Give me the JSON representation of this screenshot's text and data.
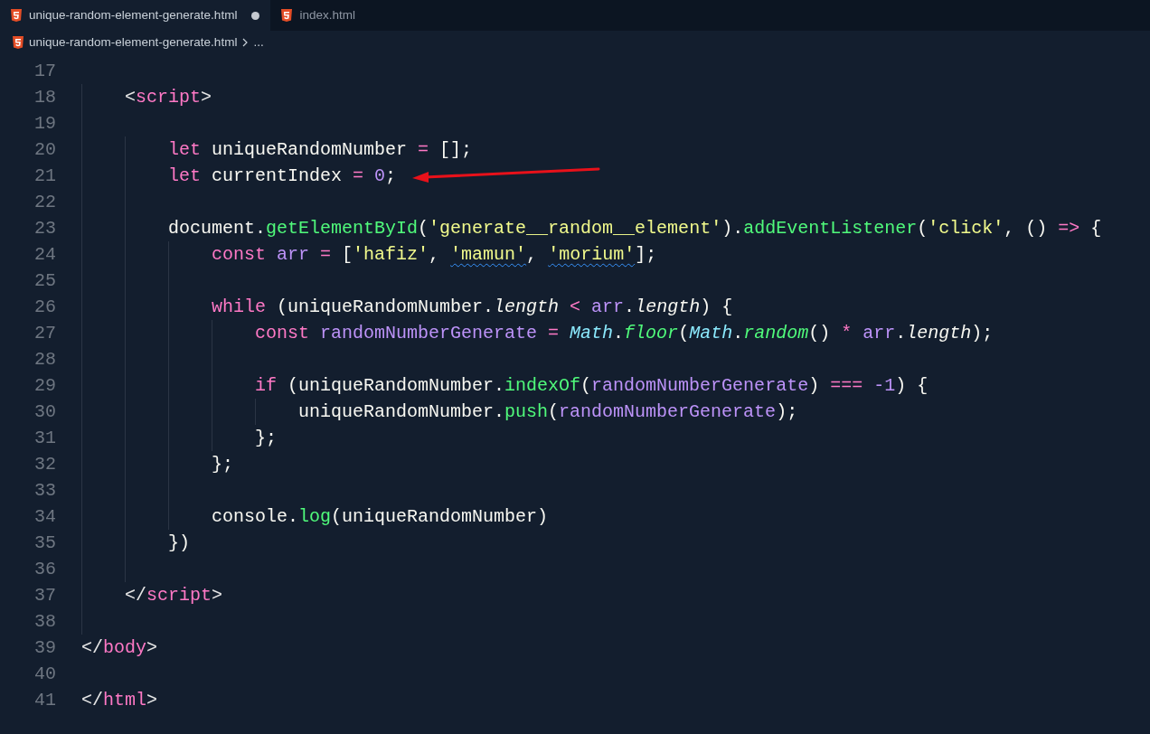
{
  "tabs": [
    {
      "label": "unique-random-element-generate.html",
      "selected": true,
      "modified": true
    },
    {
      "label": "index.html",
      "selected": false,
      "modified": false
    }
  ],
  "breadcrumb": {
    "file": "unique-random-element-generate.html",
    "ellipsis": "..."
  },
  "lines": [
    {
      "children": [
        {
          "number": "17"
        },
        {
          "number": "18",
          "tokens": [
            {
              "text": "<",
              "kind": "punct"
            },
            {
              "text": "script",
              "kind": "tag"
            },
            {
              "text": ">",
              "kind": "punct"
            }
          ],
          "children": [
            {
              "number": "19"
            },
            {
              "number": "20",
              "tokens": [
                {
                  "text": "let",
                  "kind": "kw"
                },
                {
                  "text": " uniqueRandomNumber ",
                  "kind": "plain"
                },
                {
                  "text": "=",
                  "kind": "op"
                },
                {
                  "text": " [];",
                  "kind": "plain"
                }
              ]
            },
            {
              "number": "21",
              "tokens": [
                {
                  "text": "let",
                  "kind": "kw"
                },
                {
                  "text": " currentIndex ",
                  "kind": "plain"
                },
                {
                  "text": "= ",
                  "kind": "op"
                },
                {
                  "text": "0",
                  "kind": "num"
                },
                {
                  "text": ";",
                  "kind": "plain"
                }
              ]
            },
            {
              "number": "22"
            },
            {
              "number": "23",
              "tokens": [
                {
                  "text": "document.",
                  "kind": "plain"
                },
                {
                  "text": "getElementById",
                  "kind": "fn"
                },
                {
                  "text": "(",
                  "kind": "plain"
                },
                {
                  "text": "'generate__random__element'",
                  "kind": "str"
                },
                {
                  "text": ").",
                  "kind": "plain"
                },
                {
                  "text": "addEventListener",
                  "kind": "fn"
                },
                {
                  "text": "(",
                  "kind": "plain"
                },
                {
                  "text": "'click'",
                  "kind": "str"
                },
                {
                  "text": ", () ",
                  "kind": "plain"
                },
                {
                  "text": "=>",
                  "kind": "op"
                },
                {
                  "text": " {",
                  "kind": "plain"
                }
              ],
              "children": [
                {
                  "number": "24",
                  "tokens": [
                    {
                      "text": "const ",
                      "kind": "kw"
                    },
                    {
                      "text": "arr ",
                      "kind": "var"
                    },
                    {
                      "text": "=",
                      "kind": "op"
                    },
                    {
                      "text": " [",
                      "kind": "plain"
                    },
                    {
                      "text": "'hafiz'",
                      "kind": "str"
                    },
                    {
                      "text": ", ",
                      "kind": "plain"
                    },
                    {
                      "text": "'mamun'",
                      "kind": "str",
                      "squiggle": true
                    },
                    {
                      "text": ", ",
                      "kind": "plain"
                    },
                    {
                      "text": "'morium'",
                      "kind": "str",
                      "squiggle": true
                    },
                    {
                      "text": "];",
                      "kind": "plain"
                    }
                  ]
                },
                {
                  "number": "25"
                },
                {
                  "number": "26",
                  "tokens": [
                    {
                      "text": "while",
                      "kind": "kw"
                    },
                    {
                      "text": " (uniqueRandomNumber.",
                      "kind": "plain"
                    },
                    {
                      "text": "length ",
                      "kind": "prop"
                    },
                    {
                      "text": "< ",
                      "kind": "op"
                    },
                    {
                      "text": "arr",
                      "kind": "var"
                    },
                    {
                      "text": ".",
                      "kind": "plain"
                    },
                    {
                      "text": "length",
                      "kind": "prop"
                    },
                    {
                      "text": ") {",
                      "kind": "plain"
                    }
                  ],
                  "children": [
                    {
                      "number": "27",
                      "tokens": [
                        {
                          "text": "const ",
                          "kind": "kw"
                        },
                        {
                          "text": "randomNumberGenerate ",
                          "kind": "var"
                        },
                        {
                          "text": "= ",
                          "kind": "op"
                        },
                        {
                          "text": "Math",
                          "kind": "cls"
                        },
                        {
                          "text": ".",
                          "kind": "plain"
                        },
                        {
                          "text": "floor",
                          "kind": "fni"
                        },
                        {
                          "text": "(",
                          "kind": "plain"
                        },
                        {
                          "text": "Math",
                          "kind": "cls"
                        },
                        {
                          "text": ".",
                          "kind": "plain"
                        },
                        {
                          "text": "random",
                          "kind": "fni"
                        },
                        {
                          "text": "() ",
                          "kind": "plain"
                        },
                        {
                          "text": "* ",
                          "kind": "op"
                        },
                        {
                          "text": "arr",
                          "kind": "var"
                        },
                        {
                          "text": ".",
                          "kind": "plain"
                        },
                        {
                          "text": "length",
                          "kind": "prop"
                        },
                        {
                          "text": ");",
                          "kind": "plain"
                        }
                      ]
                    },
                    {
                      "number": "28"
                    },
                    {
                      "number": "29",
                      "tokens": [
                        {
                          "text": "if",
                          "kind": "kw"
                        },
                        {
                          "text": " (uniqueRandomNumber.",
                          "kind": "plain"
                        },
                        {
                          "text": "indexOf",
                          "kind": "fn"
                        },
                        {
                          "text": "(",
                          "kind": "plain"
                        },
                        {
                          "text": "randomNumberGenerate",
                          "kind": "var"
                        },
                        {
                          "text": ") ",
                          "kind": "plain"
                        },
                        {
                          "text": "=== ",
                          "kind": "op"
                        },
                        {
                          "text": "-1",
                          "kind": "num"
                        },
                        {
                          "text": ") {",
                          "kind": "plain"
                        }
                      ],
                      "children": [
                        {
                          "number": "30",
                          "tokens": [
                            {
                              "text": "uniqueRandomNumber.",
                              "kind": "plain"
                            },
                            {
                              "text": "push",
                              "kind": "fn"
                            },
                            {
                              "text": "(",
                              "kind": "plain"
                            },
                            {
                              "text": "randomNumberGenerate",
                              "kind": "var"
                            },
                            {
                              "text": ");",
                              "kind": "plain"
                            }
                          ]
                        }
                      ]
                    },
                    {
                      "number": "31",
                      "tokens": [
                        {
                          "text": "};",
                          "kind": "plain"
                        }
                      ]
                    }
                  ]
                },
                {
                  "number": "32",
                  "tokens": [
                    {
                      "text": "};",
                      "kind": "plain"
                    }
                  ]
                },
                {
                  "number": "33"
                },
                {
                  "number": "34",
                  "tokens": [
                    {
                      "text": "console.",
                      "kind": "plain"
                    },
                    {
                      "text": "log",
                      "kind": "fn"
                    },
                    {
                      "text": "(uniqueRandomNumber)",
                      "kind": "plain"
                    }
                  ]
                }
              ]
            },
            {
              "number": "35",
              "tokens": [
                {
                  "text": "})",
                  "kind": "plain"
                }
              ]
            },
            {
              "number": "36"
            }
          ]
        },
        {
          "number": "37",
          "tokens": [
            {
              "text": "</",
              "kind": "punct"
            },
            {
              "text": "script",
              "kind": "tag"
            },
            {
              "text": ">",
              "kind": "punct"
            }
          ]
        },
        {
          "number": "38"
        }
      ]
    },
    {
      "number": "39",
      "tokens": [
        {
          "text": "</",
          "kind": "punct"
        },
        {
          "text": "body",
          "kind": "tag"
        },
        {
          "text": ">",
          "kind": "punct"
        }
      ]
    },
    {
      "number": "40"
    },
    {
      "number": "41",
      "tokens": [
        {
          "text": "</",
          "kind": "punct"
        },
        {
          "text": "html",
          "kind": "tag"
        },
        {
          "text": ">",
          "kind": "punct"
        }
      ]
    }
  ]
}
